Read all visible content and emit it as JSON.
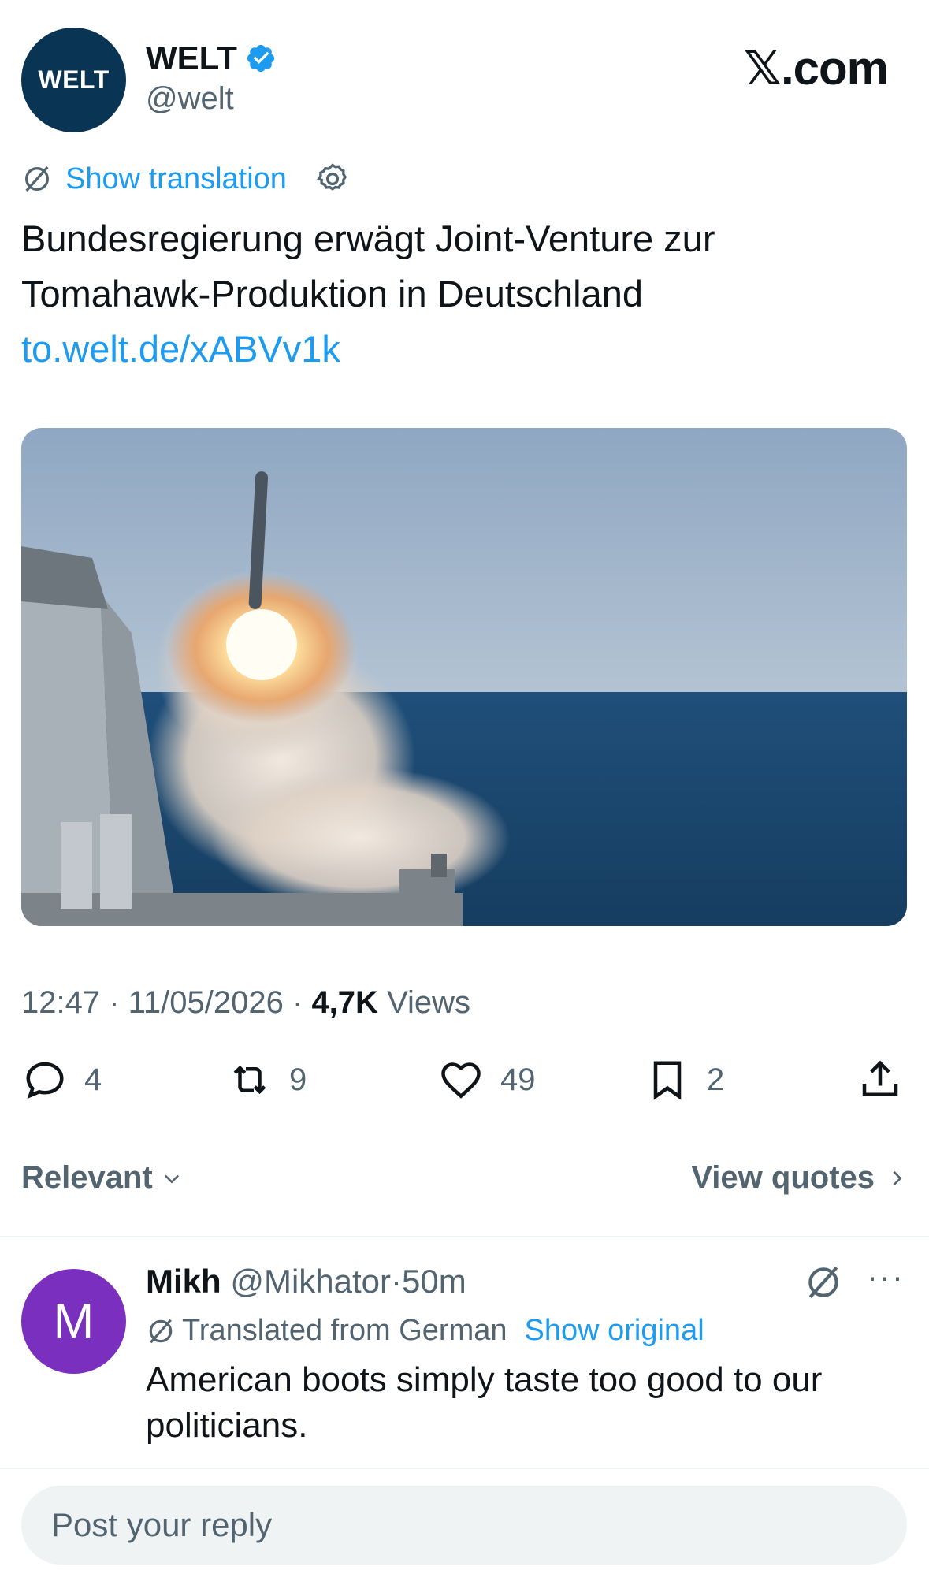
{
  "author": {
    "logo_text": "WELT",
    "name": "WELT",
    "handle": "@welt",
    "verified_icon": "verified-badge-icon"
  },
  "brand": {
    "site": "𝕏.com"
  },
  "translation": {
    "label": "Show translation",
    "icon": "translate-off-icon",
    "settings_icon": "gear-icon"
  },
  "tweet": {
    "text_line1": "Bundesregierung erwägt Joint-Venture zur",
    "text_line2": "Tomahawk-Produktion in Deutschland",
    "link": "to.welt.de/xABVv1k",
    "media_icon": "missile-launch-photo"
  },
  "meta": {
    "time": "12:47",
    "sep1": " · ",
    "date": "11/05/2026",
    "sep2": " · ",
    "views_count": "4,7K",
    "views_label": "Views"
  },
  "actions": {
    "replies": "4",
    "reposts": "9",
    "likes": "49",
    "bookmarks": "2"
  },
  "sort": {
    "label": "Relevant",
    "view_quotes": "View quotes"
  },
  "reply": {
    "avatar_letter": "M",
    "name": "Mikh",
    "handle": "@Mikhator",
    "sep": "·",
    "time": "50m",
    "translated_label": "Translated from German",
    "show_original": "Show original",
    "more": "···",
    "body": "American boots simply taste too good to our politicians."
  },
  "composer": {
    "placeholder": "Post your reply"
  },
  "colors": {
    "accent": "#1d9bf0",
    "muted": "#536471",
    "welt_navy": "#0a3453",
    "avatar_purple": "#7b2fbe"
  }
}
